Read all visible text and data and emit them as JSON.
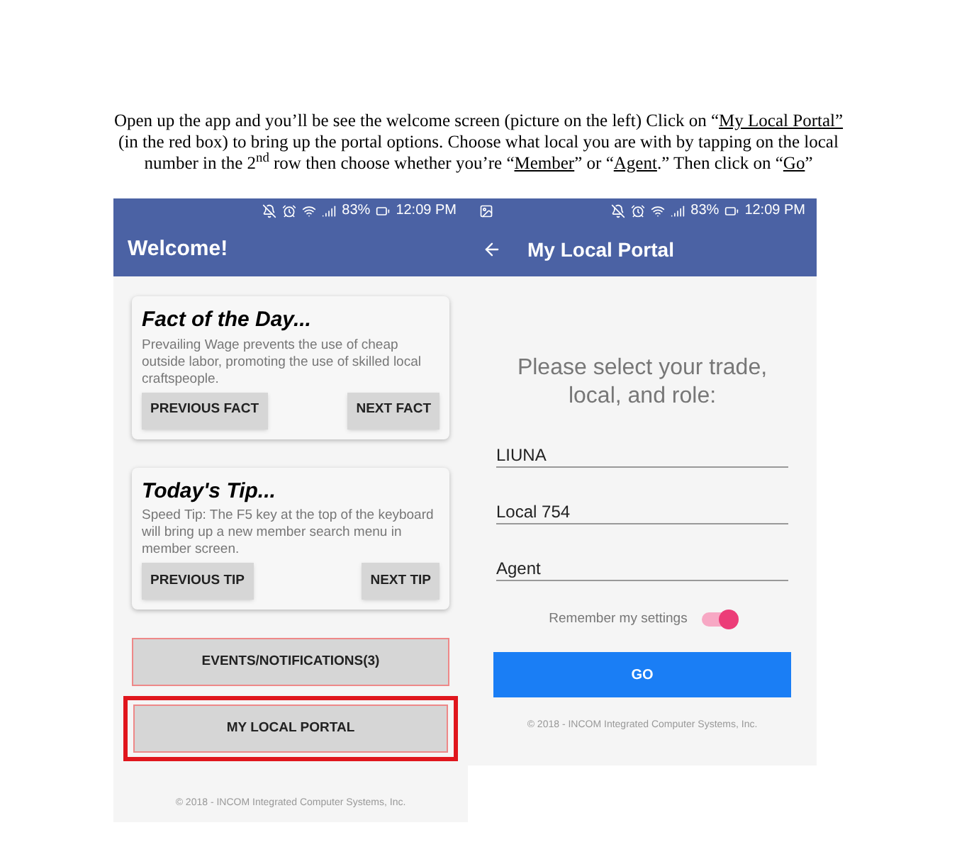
{
  "instructions": {
    "segments": [
      {
        "text": "Open up the app and you’ll be see the welcome screen (picture on the left) Click on “",
        "link": false
      },
      {
        "text": "My Local Portal”",
        "link": true
      },
      {
        "text": " (in the red box) to bring up the portal options.  Choose what local you are with by tapping on the local number in the 2$^{nd}$ row then choose whether you’re “",
        "link": false
      },
      {
        "text": "Member",
        "link": true
      },
      {
        "text": "” or “",
        "link": false
      },
      {
        "text": "Agent",
        "link": true
      },
      {
        "text": ".” Then click on “",
        "link": false
      },
      {
        "text": "Go",
        "link": true
      },
      {
        "text": "”",
        "link": false
      }
    ]
  },
  "welcome_screen": {
    "status_bar": {
      "battery": "83%",
      "time": "12:09 PM"
    },
    "title": "Welcome!",
    "cards": [
      {
        "title": "Fact of the Day...",
        "body": "Prevailing Wage prevents the use of cheap outside labor, promoting the use of skilled local craftspeople.",
        "buttons": [
          "PREVIOUS FACT",
          "NEXT FACT"
        ]
      },
      {
        "title": "Today's Tip...",
        "body": "Speed Tip: The F5 key at the top of the keyboard will bring up a new member search menu in member screen.",
        "buttons": [
          "PREVIOUS TIP",
          "NEXT TIP"
        ]
      }
    ],
    "buttons": [
      {
        "label": "EVENTS/NOTIFICATIONS(3)",
        "highlighted": false
      },
      {
        "label": "MY LOCAL PORTAL",
        "highlighted": true
      }
    ],
    "footer": "© 2018 - INCOM Integrated Computer Systems, Inc."
  },
  "portal_screen": {
    "status_bar": {
      "battery": "83%",
      "time": "12:09 PM"
    },
    "title": "My Local Portal",
    "prompt": "Please select your trade, local, and role:",
    "fields": [
      {
        "value": "LIUNA"
      },
      {
        "value": "Local 754"
      },
      {
        "value": "Agent"
      }
    ],
    "remember": {
      "label": "Remember my settings",
      "on": true
    },
    "button": "GO",
    "footer": "© 2018 - INCOM Integrated Computer Systems, Inc."
  }
}
